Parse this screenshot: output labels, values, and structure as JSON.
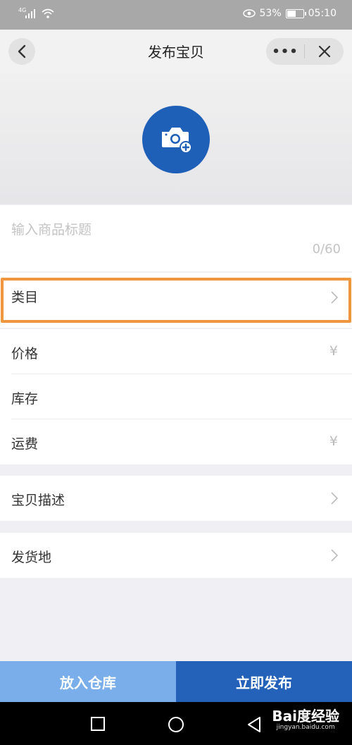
{
  "status_bar": {
    "network": "4G",
    "battery_percent": "53%",
    "time": "05:10"
  },
  "nav": {
    "title": "发布宝贝",
    "more_label": "•••"
  },
  "product_title": {
    "placeholder": "输入商品标题",
    "counter": "0/60"
  },
  "rows": {
    "category": "类目",
    "price": "价格",
    "stock": "库存",
    "shipping_fee": "运费",
    "description": "宝贝描述",
    "ship_from": "发货地",
    "currency_symbol": "¥"
  },
  "buttons": {
    "warehouse": "放入仓库",
    "publish": "立即发布"
  },
  "watermark": {
    "brand": "Bai度经验",
    "url": "jingyan.baidu.com"
  },
  "colors": {
    "accent": "#2461b8",
    "accent_light": "#7aaeea",
    "highlight": "#f0963e"
  }
}
